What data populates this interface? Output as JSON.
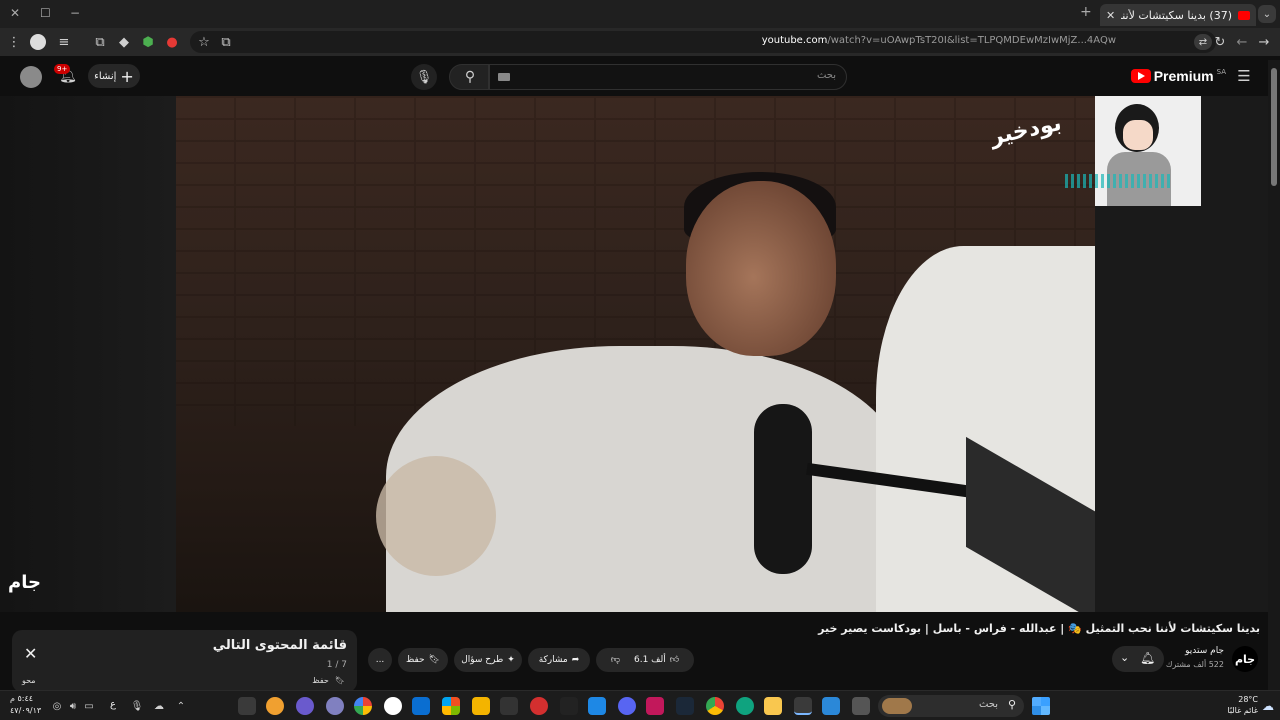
{
  "browser": {
    "tab_title": "(37) بدينا سكيتشات لأننا نحب...",
    "url_host": "youtube.com",
    "url_rest": "/watch?v=uOAwpTsT20I&list=TLPQMDEwMzIwMjZ...4AQw",
    "window_buttons": [
      "✕",
      "☐",
      "−"
    ],
    "new_tab": "+"
  },
  "youtube": {
    "logo_text": "Premium",
    "country_code": "SA",
    "search_placeholder": "بحث",
    "create_label": "إنشاء",
    "notification_badge": "9+",
    "watermark_right": "بودخير",
    "watermark_left": "جام"
  },
  "video": {
    "title": "بدينا سكيتشات لأننا نحب التمثيل 🎭 | عبدالله - فراس - باسل | بودكاست يصير خير",
    "channel_name": "جام ستديو",
    "channel_logo": "جام",
    "subscribers": "522 ألف مشترك",
    "likes": "6.1 ألف",
    "share_label": "مشاركة",
    "ask_label": "طرح سؤال",
    "save_label": "حفظ",
    "more_label": "..."
  },
  "queue": {
    "title": "قائمة المحتوى التالي",
    "count": "1 / 7",
    "save_label": "حفظ",
    "close": "✕",
    "clear_label": "محو"
  },
  "taskbar": {
    "search_placeholder": "بحث",
    "clock_time": "٥:٤٤ م",
    "clock_date": "٤٧/٠٩/١٣",
    "keyboard_lang": "ع",
    "temperature": "28°C",
    "weather_desc": "غائم غالبًا"
  }
}
